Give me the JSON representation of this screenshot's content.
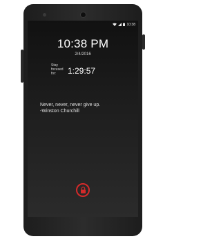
{
  "status_bar": {
    "wifi_icon": "wifi-icon",
    "signal_icon": "signal-icon",
    "battery_icon": "battery-icon",
    "time": "10:38"
  },
  "lock_screen": {
    "clock": "10:38 PM",
    "date": "2/4/2016",
    "focus_label_line1": "Stay",
    "focus_label_line2": "focused",
    "focus_label_line3": "for:",
    "focus_time": "1:29:57",
    "quote": "Never, never, never give up.",
    "author": "-Winston Churchill"
  },
  "unlock_button": {
    "icon": "lock-icon",
    "accent_color": "#d42a2a"
  }
}
